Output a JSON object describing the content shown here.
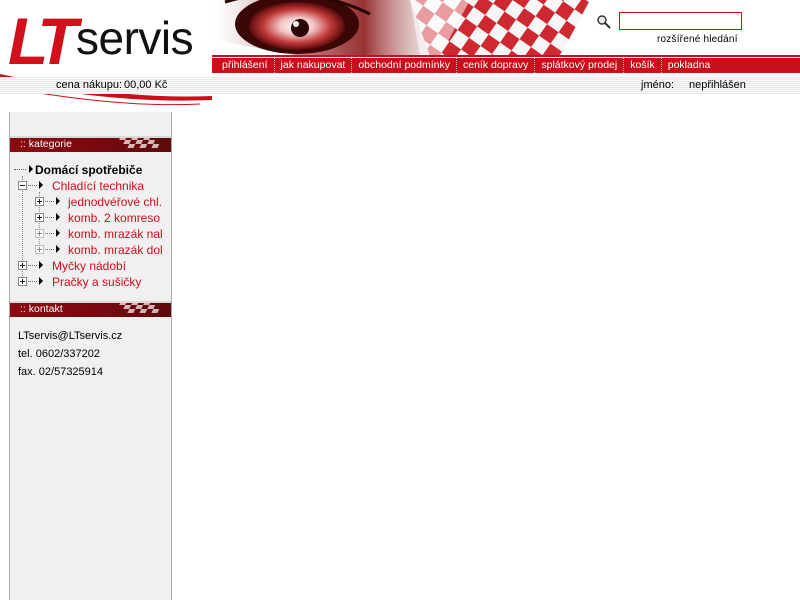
{
  "header": {
    "logo": {
      "lt": "LT",
      "servis": "servis"
    },
    "search": {
      "value": "",
      "advanced_label": "rozšířené hledání"
    },
    "nav": [
      "přihlášení",
      "jak nakupovat",
      "obchodní podmínky",
      "ceník dopravy",
      "splátkový prodej",
      "košík",
      "pokladna"
    ],
    "cart": {
      "label": "cena nákupu:",
      "value": "00,00 Kč"
    },
    "user": {
      "label": "jméno:",
      "value": "nepřihlášen"
    }
  },
  "sidebar": {
    "categories": {
      "title": ":: kategorie",
      "root": "Domácí spotřebiče",
      "items": [
        {
          "label": "Chladící technika",
          "children": [
            "jednodvéřové chl.",
            "komb. 2 komreso",
            "komb. mrazák nal",
            "komb. mrazák dol"
          ]
        },
        {
          "label": "Myčky nádobí"
        },
        {
          "label": "Pračky a sušičky"
        }
      ]
    },
    "contact": {
      "title": ":: kontakt",
      "lines": [
        "LTservis@LTservis.cz",
        "tel. 0602/337202",
        "fax. 02/57325914"
      ]
    }
  },
  "colors": {
    "brand_red": "#c8101a",
    "link_red": "#c8101a",
    "sidebar_bg": "#f0f0f0"
  },
  "icons": {
    "search": "magnifier-icon"
  }
}
